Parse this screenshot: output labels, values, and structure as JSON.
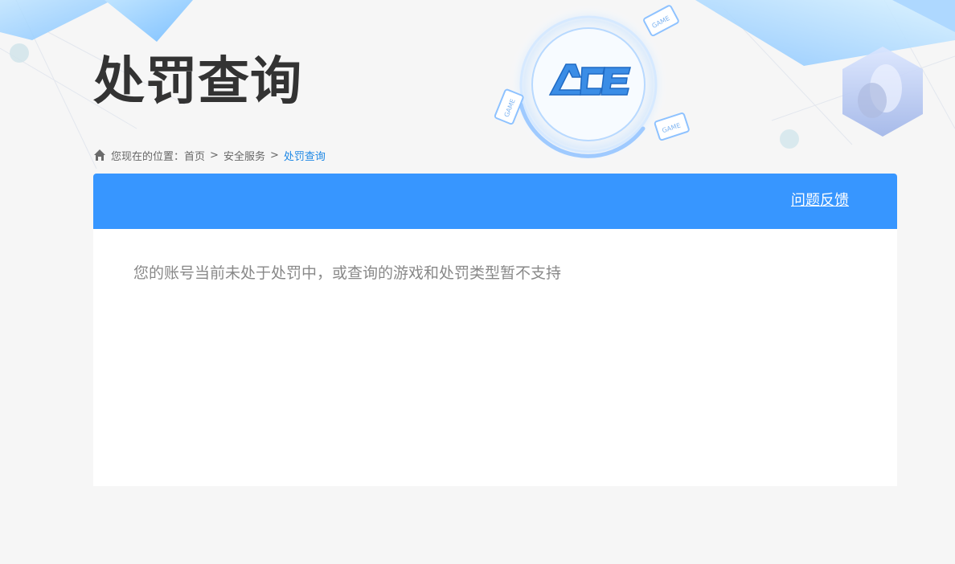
{
  "page": {
    "title": "处罚查询"
  },
  "breadcrumb": {
    "prefix": "您现在的位置：",
    "items": [
      "首页",
      "安全服务",
      "处罚查询"
    ],
    "separator": ">"
  },
  "logo": {
    "text": "ACE",
    "badge": "GAME"
  },
  "panel": {
    "feedback_label": "问题反馈",
    "message": "您的账号当前未处于处罚中，或查询的游戏和处罚类型暂不支持"
  },
  "colors": {
    "accent": "#3796ff",
    "link_current": "#1e88e5",
    "title": "#333333",
    "background": "#f6f6f6"
  },
  "icons": {
    "home": "home-icon"
  }
}
